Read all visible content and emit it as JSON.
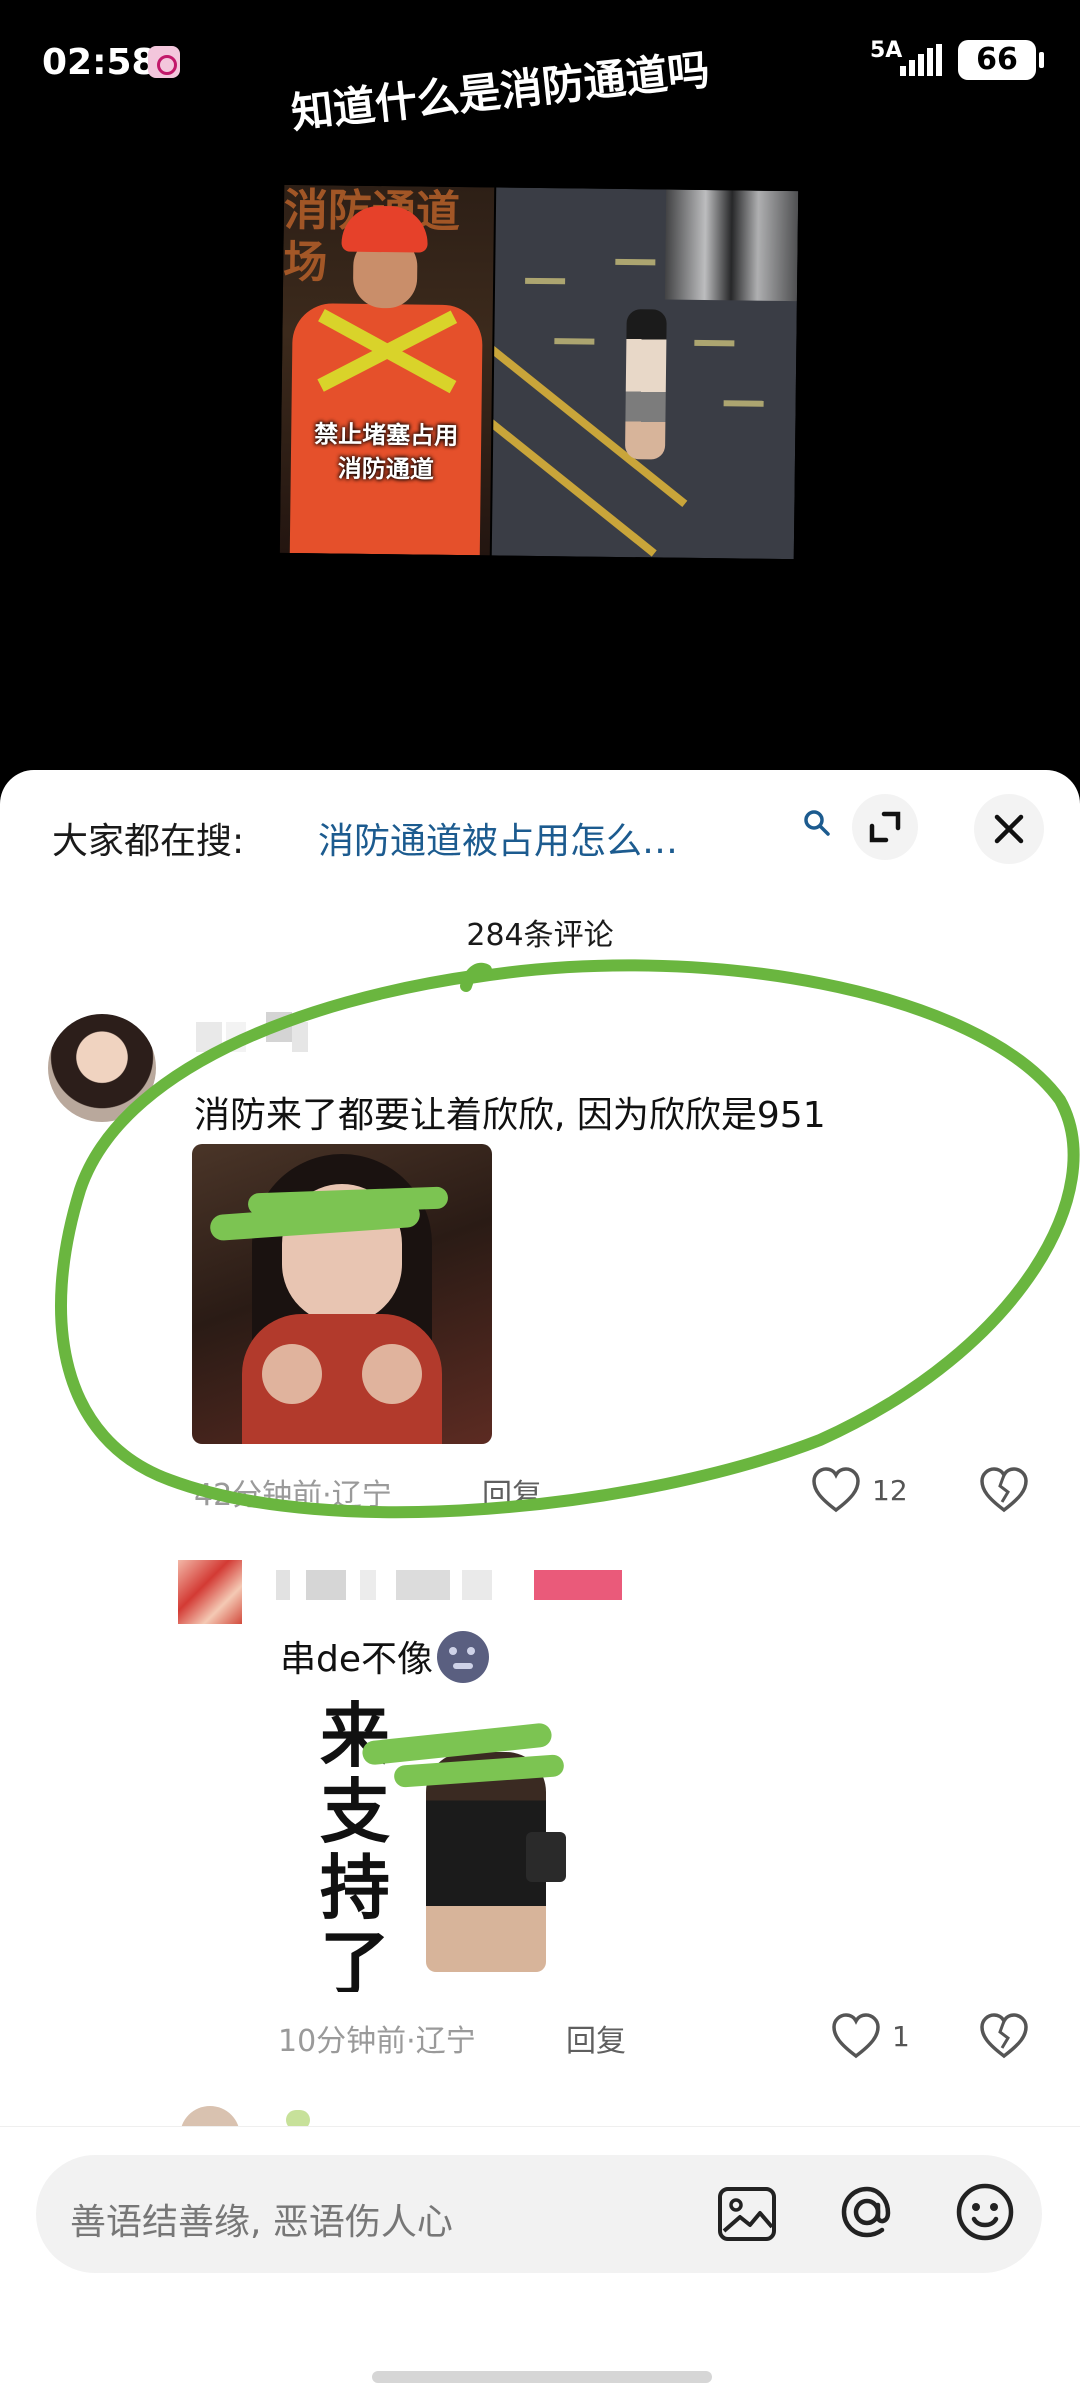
{
  "status_bar": {
    "time": "02:58",
    "network": "5A",
    "battery": "66",
    "icons": [
      "app-notification-icon",
      "signal-icon",
      "battery-icon"
    ]
  },
  "video": {
    "title": "知道什么是消防通道吗",
    "background_text": "消防通道\n场  通",
    "caption_line1": "禁止堵塞占用",
    "caption_line2": "消防通道"
  },
  "sheet": {
    "search_prefix": "大家都在搜:",
    "search_query": "消防通道被占用怎么…",
    "comment_count": "284条评论"
  },
  "comments": [
    {
      "text": "消防来了都要让着欣欣, 因为欣欣是951",
      "meta": "42分钟前·辽宁",
      "reply_label": "回复",
      "likes": "12"
    },
    {
      "text": "串de不像",
      "sticker_text": "来支持了",
      "meta": "10分钟前·辽宁",
      "reply_label": "回复",
      "likes": "1"
    }
  ],
  "input": {
    "placeholder": "善语结善缘, 恶语伤人心",
    "icons": [
      "image-icon",
      "at-icon",
      "emoji-icon"
    ]
  },
  "colors": {
    "accent_link": "#1c5b8f",
    "annotation_green": "#6ab63f",
    "sheet_bg": "#ffffff"
  }
}
